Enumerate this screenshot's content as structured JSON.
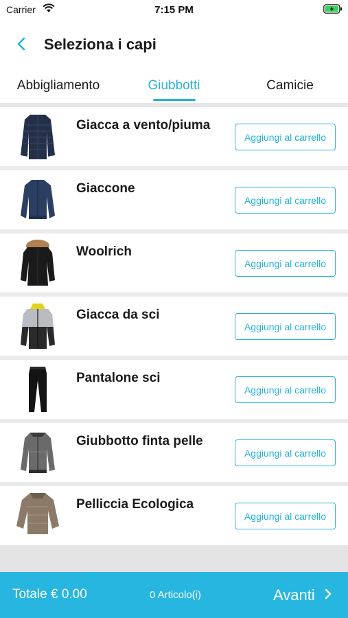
{
  "status_bar": {
    "carrier": "Carrier",
    "time": "7:15 PM",
    "icons": [
      "wifi-icon",
      "battery-charging-icon"
    ]
  },
  "nav": {
    "back_icon": "chevron-left-icon",
    "title": "Seleziona i capi"
  },
  "tabs": [
    {
      "label": "Abbigliamento",
      "active": false
    },
    {
      "label": "Giubbotti",
      "active": true
    },
    {
      "label": "Camicie",
      "active": false
    }
  ],
  "items": [
    {
      "name": "Giacca a vento/piuma",
      "button": "Aggiungi al carrello",
      "thumb": "puffer-jacket-image"
    },
    {
      "name": "Giaccone",
      "button": "Aggiungi al carrello",
      "thumb": "bomber-jacket-image"
    },
    {
      "name": "Woolrich",
      "button": "Aggiungi al carrello",
      "thumb": "parka-image"
    },
    {
      "name": "Giacca da sci",
      "button": "Aggiungi al carrello",
      "thumb": "ski-jacket-image"
    },
    {
      "name": "Pantalone sci",
      "button": "Aggiungi al carrello",
      "thumb": "ski-pants-image"
    },
    {
      "name": "Giubbotto finta pelle",
      "button": "Aggiungi al carrello",
      "thumb": "faux-leather-jacket-image"
    },
    {
      "name": "Pelliccia Ecologica",
      "button": "Aggiungi al carrello",
      "thumb": "faux-fur-coat-image"
    }
  ],
  "footer": {
    "total": "Totale € 0.00",
    "count": "0 Articolo(i)",
    "next_label": "Avanti",
    "next_icon": "chevron-right-icon"
  },
  "colors": {
    "accent": "#25b3da",
    "footer_bg": "#27b6df",
    "list_bg": "#ebebeb"
  }
}
